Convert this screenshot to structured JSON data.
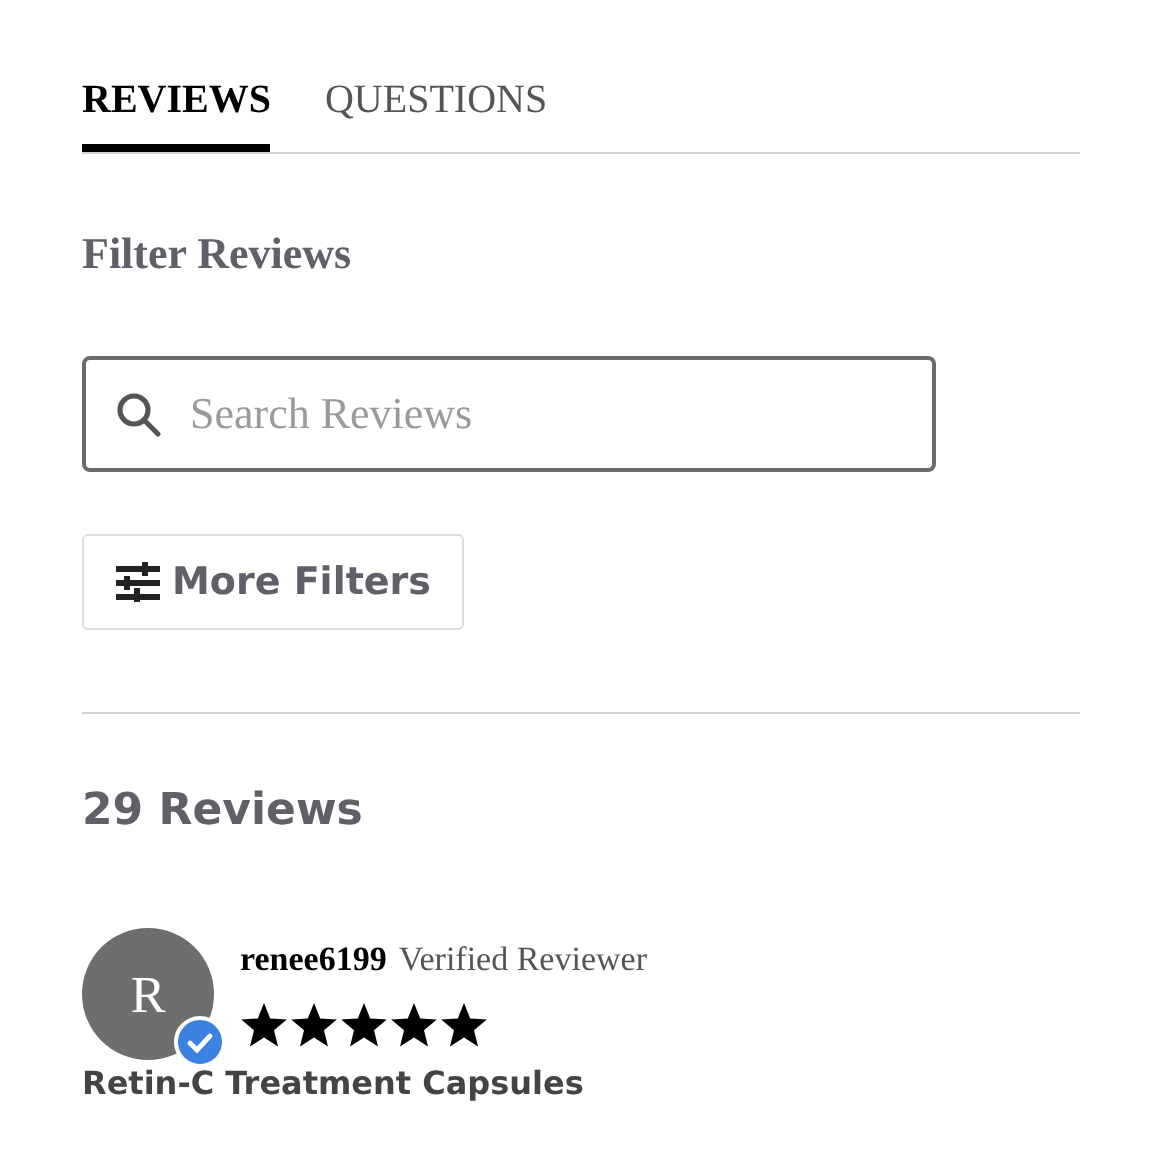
{
  "tabs": [
    {
      "label": "REVIEWS",
      "selected": true
    },
    {
      "label": "QUESTIONS",
      "selected": false
    }
  ],
  "filter_heading": "Filter Reviews",
  "search": {
    "placeholder": "Search Reviews"
  },
  "more_filters_button": "More Filters",
  "review_count": "29 Reviews",
  "reviews": [
    {
      "avatar_letter": "R",
      "verified": true,
      "username": "renee6199",
      "badge": "Verified Reviewer",
      "stars": 5,
      "title": "Retin-C Treatment Capsules"
    }
  ]
}
